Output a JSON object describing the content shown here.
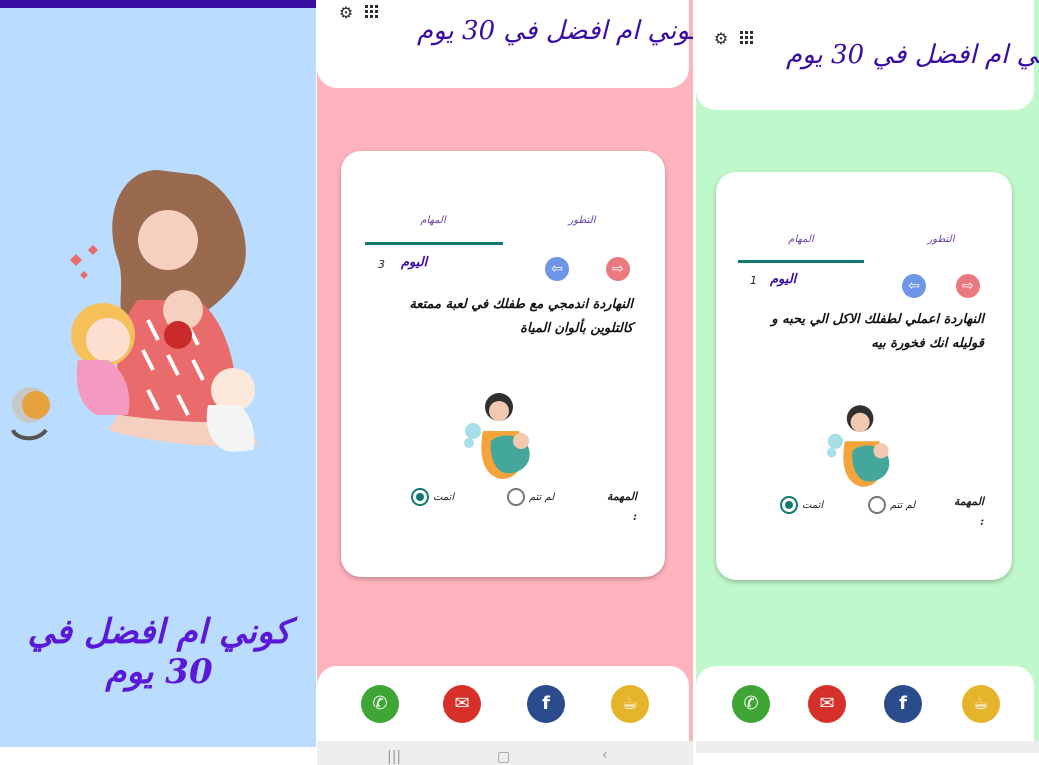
{
  "app": {
    "title": "كوني ام افضل في 30 يوم"
  },
  "splash": {
    "title": "كوني ام افضل في 30 يوم",
    "background": "#badcff",
    "title_color": "#5a18d8"
  },
  "screens": [
    {
      "background": "#ffb3bc",
      "tabs": [
        "التطور",
        "المهام"
      ],
      "selected_tab": "المهام",
      "day_label": "اليوم",
      "day_number": "3",
      "task_text": "النهاردة اندمجي مع طفلك في لعبة ممتعة كالتلوين بألوان المياة",
      "mission_label": "المهمة",
      "mission_colon": ":",
      "options": [
        "لم تتم",
        "اتمت"
      ],
      "selected_option": "اتمت"
    },
    {
      "background": "#bff8cb",
      "tabs": [
        "التطور",
        "المهام"
      ],
      "selected_tab": "المهام",
      "day_label": "اليوم",
      "day_number": "1",
      "task_text": "النهاردة اعملي لطفلك الاكل الي يحبه و قوليله انك فخورة بيه",
      "mission_label": "المهمة",
      "mission_colon": ":",
      "options": [
        "لم تتم",
        "اتمت"
      ],
      "selected_option": "اتمت"
    }
  ],
  "icons": {
    "settings": "gear-icon",
    "menu": "grid-icon",
    "prev": "arrow-left-icon",
    "next": "arrow-right-icon"
  },
  "share": {
    "whatsapp": "whatsapp-icon",
    "email": "mail-icon",
    "facebook": "f",
    "coffee": "coffee-icon",
    "colors": {
      "whatsapp": "#3fa535",
      "email": "#d6302a",
      "facebook": "#2b4c8c",
      "coffee": "#e6b42a"
    }
  }
}
